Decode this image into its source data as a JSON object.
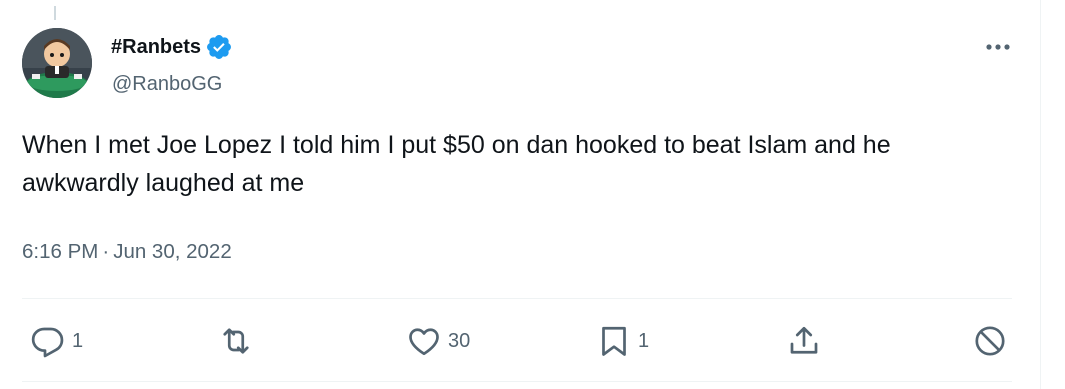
{
  "author": {
    "display_name": "#Ranbets",
    "handle": "@RanboGG",
    "verified": true,
    "verified_color": "#1d9bf0"
  },
  "tweet": {
    "text": "When I met Joe Lopez I told him I put $50 on dan hooked to beat Islam and he awkwardly laughed at me",
    "time": "6:16 PM",
    "separator": "·",
    "date": "Jun 30, 2022"
  },
  "actions": {
    "reply": {
      "icon": "reply-icon",
      "count": "1"
    },
    "retweet": {
      "icon": "retweet-icon"
    },
    "like": {
      "icon": "heart-icon",
      "count": "30"
    },
    "bookmark": {
      "icon": "bookmark-icon",
      "count": "1"
    },
    "share": {
      "icon": "share-icon"
    },
    "block": {
      "icon": "block-icon"
    }
  },
  "more_menu": {
    "icon": "more-dots-icon"
  },
  "colors": {
    "text_primary": "#0f1419",
    "text_secondary": "#536471",
    "divider": "#eff3f4"
  }
}
